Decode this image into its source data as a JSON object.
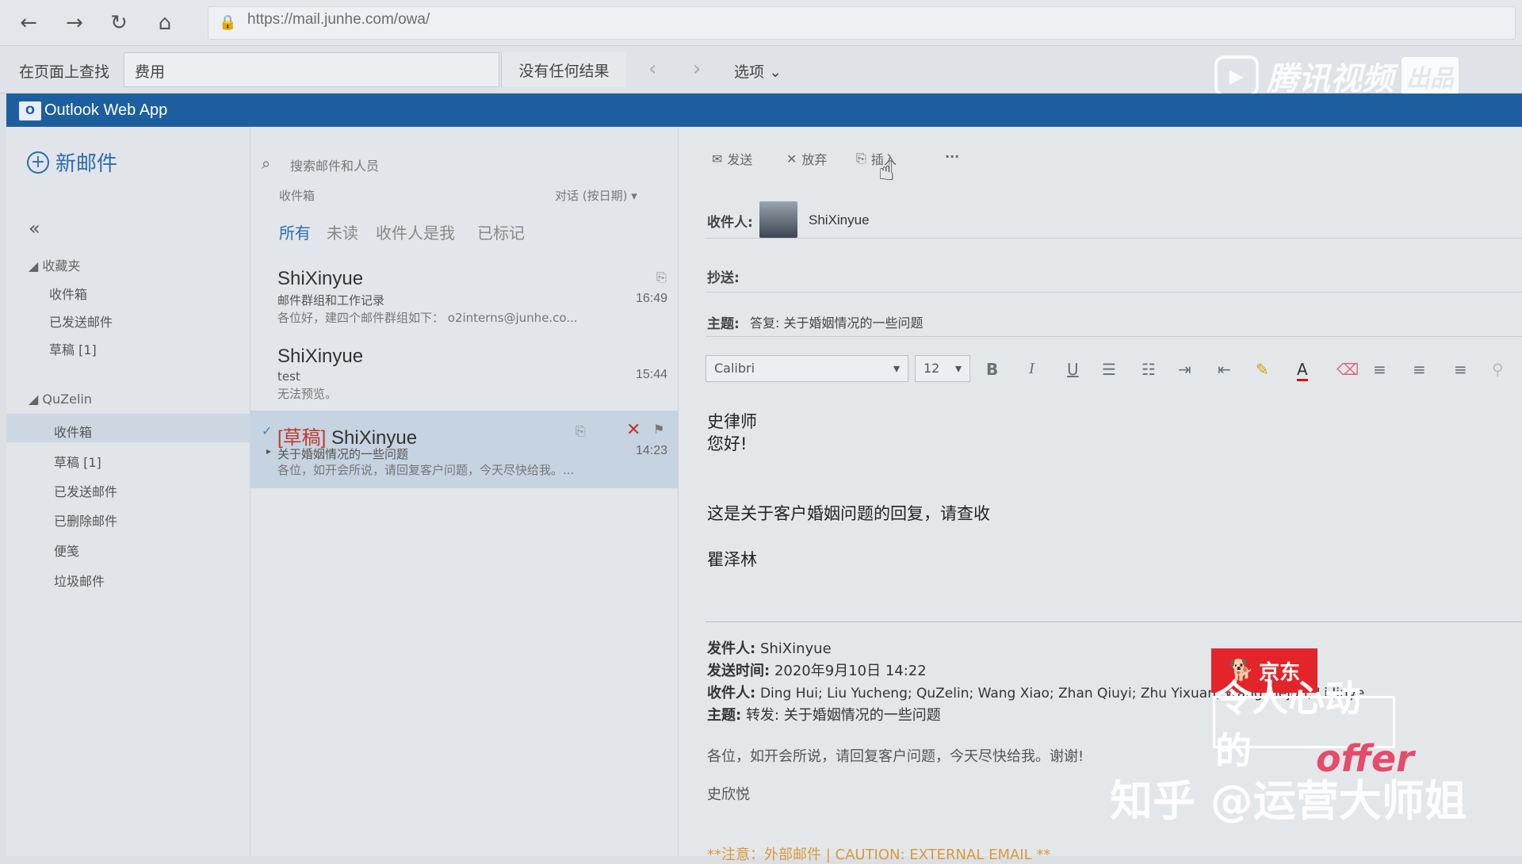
{
  "browser": {
    "url": "https://mail.junhe.com/owa/"
  },
  "find_bar": {
    "label": "在页面上查找",
    "query": "费用",
    "result": "没有任何结果",
    "options": "选项"
  },
  "watermarks": {
    "tencent": "腾讯视频",
    "tencent_badge": "出品",
    "jd": "京东",
    "show": "令人心动的",
    "offer": "offer",
    "zhihu": "知乎 @运营大师姐"
  },
  "app": {
    "title": "Outlook Web App"
  },
  "folders": {
    "new_mail": "新邮件",
    "favorites_header": "收藏夹",
    "favorites": [
      "收件箱",
      "已发送邮件",
      "草稿 [1]"
    ],
    "account_header": "QuZelin",
    "account_items": [
      "收件箱",
      "草稿 [1]",
      "已发送邮件",
      "已删除邮件",
      "便笺",
      "垃圾邮件"
    ]
  },
  "list": {
    "search_placeholder": "搜索邮件和人员",
    "folder_name": "收件箱",
    "sort": "对话 (按日期)",
    "filters": [
      "所有",
      "未读",
      "收件人是我",
      "已标记"
    ],
    "messages": [
      {
        "sender": "ShiXinyue",
        "subject": "邮件群组和工作记录",
        "preview": "各位好，建四个邮件群组如下： o2interns@junhe.co...",
        "time": "16:49"
      },
      {
        "sender": "ShiXinyue",
        "subject": "test",
        "preview": "无法预览。",
        "time": "15:44"
      },
      {
        "draft_tag": "[草稿]",
        "sender": "ShiXinyue",
        "subject": "关于婚姻情况的一些问题",
        "preview": "各位，如开会所说，请回复客户问题，今天尽快给我。...",
        "time": "14:23"
      }
    ]
  },
  "compose": {
    "toolbar": {
      "send": "发送",
      "discard": "放弃",
      "insert": "插入",
      "more": "···"
    },
    "to_label": "收件人:",
    "to_value": "ShiXinyue",
    "cc_label": "抄送:",
    "subject_label": "主题:",
    "subject_value": "答复: 关于婚姻情况的一些问题",
    "font": "Calibri",
    "size": "12",
    "body": [
      "史律师",
      "您好!",
      "这是关于客户婚姻问题的回复，请查收",
      "瞿泽林"
    ],
    "quoted": {
      "from_key": "发件人:",
      "from_val": "ShiXinyue",
      "sent_key": "发送时间:",
      "sent_val": "2020年9月10日 14:22",
      "to_key": "收件人:",
      "to_val": "Ding Hui; Liu Yucheng; QuZelin; Wang Xiao; Zhan Qiuyi; Zhu Yixuan; Wang Tiejun; Li Jinye",
      "subject_key": "主题:",
      "subject_val": "转发: 关于婚姻情况的一些问题",
      "body": "各位，如开会所说，请回复客户问题，今天尽快给我。谢谢!",
      "signature": "史欣悦",
      "caution": "**注意：外部邮件 | CAUTION: EXTERNAL EMAIL **"
    }
  },
  "colors": {
    "owa_blue": "#1d5f9e",
    "draft_red": "#c0392b",
    "link_blue": "#2b6cb0"
  }
}
